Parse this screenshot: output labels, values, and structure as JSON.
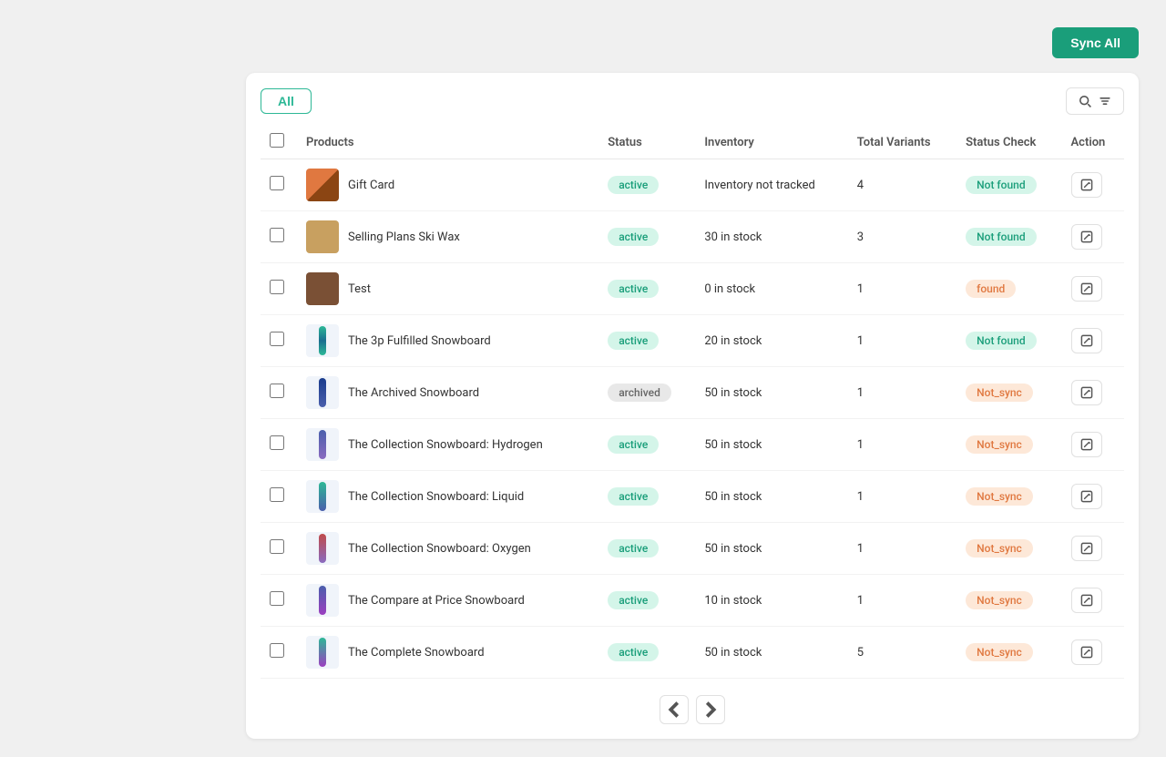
{
  "header": {
    "sync_all_label": "Sync All"
  },
  "toolbar": {
    "all_label": "All",
    "search_placeholder": "Search"
  },
  "table": {
    "columns": [
      "Products",
      "Status",
      "Inventory",
      "Total Variants",
      "Status Check",
      "Action"
    ],
    "rows": [
      {
        "id": 1,
        "name": "Gift Card",
        "img_type": "gift",
        "status": "active",
        "status_badge_class": "badge-active",
        "inventory": "Inventory not tracked",
        "total_variants": "4",
        "status_check": "Not found",
        "status_check_class": "badge-not-found"
      },
      {
        "id": 2,
        "name": "Selling Plans Ski Wax",
        "img_type": "ski",
        "status": "active",
        "status_badge_class": "badge-active",
        "inventory": "30 in stock",
        "total_variants": "3",
        "status_check": "Not found",
        "status_check_class": "badge-not-found"
      },
      {
        "id": 3,
        "name": "Test",
        "img_type": "test",
        "status": "active",
        "status_badge_class": "badge-active",
        "inventory": "0 in stock",
        "total_variants": "1",
        "status_check": "found",
        "status_check_class": "badge-found"
      },
      {
        "id": 4,
        "name": "The 3p Fulfilled Snowboard",
        "img_type": "3p",
        "status": "active",
        "status_badge_class": "badge-active",
        "inventory": "20 in stock",
        "total_variants": "1",
        "status_check": "Not found",
        "status_check_class": "badge-not-found"
      },
      {
        "id": 5,
        "name": "The Archived Snowboard",
        "img_type": "archived",
        "status": "archived",
        "status_badge_class": "badge-archived",
        "inventory": "50 in stock",
        "total_variants": "1",
        "status_check": "Not_sync",
        "status_check_class": "badge-not-sync"
      },
      {
        "id": 6,
        "name": "The Collection Snowboard: Hydrogen",
        "img_type": "hydrogen",
        "status": "active",
        "status_badge_class": "badge-active",
        "inventory": "50 in stock",
        "total_variants": "1",
        "status_check": "Not_sync",
        "status_check_class": "badge-not-sync"
      },
      {
        "id": 7,
        "name": "The Collection Snowboard: Liquid",
        "img_type": "liquid",
        "status": "active",
        "status_badge_class": "badge-active",
        "inventory": "50 in stock",
        "total_variants": "1",
        "status_check": "Not_sync",
        "status_check_class": "badge-not-sync"
      },
      {
        "id": 8,
        "name": "The Collection Snowboard: Oxygen",
        "img_type": "oxygen",
        "status": "active",
        "status_badge_class": "badge-active",
        "inventory": "50 in stock",
        "total_variants": "1",
        "status_check": "Not_sync",
        "status_check_class": "badge-not-sync"
      },
      {
        "id": 9,
        "name": "The Compare at Price Snowboard",
        "img_type": "compare",
        "status": "active",
        "status_badge_class": "badge-active",
        "inventory": "10 in stock",
        "total_variants": "1",
        "status_check": "Not_sync",
        "status_check_class": "badge-not-sync"
      },
      {
        "id": 10,
        "name": "The Complete Snowboard",
        "img_type": "complete",
        "status": "active",
        "status_badge_class": "badge-active",
        "inventory": "50 in stock",
        "total_variants": "5",
        "status_check": "Not_sync",
        "status_check_class": "badge-not-sync"
      }
    ]
  },
  "pagination": {
    "prev_label": "‹",
    "next_label": "›"
  },
  "colors": {
    "accent": "#1a9e7a",
    "badge_active_bg": "#d4f5e9",
    "badge_active_text": "#1a9e7a",
    "badge_not_found_bg": "#d4f5e9",
    "badge_not_found_text": "#1a9e7a",
    "badge_found_bg": "#fde8d8",
    "badge_found_text": "#e07840",
    "badge_not_sync_bg": "#fde8d8",
    "badge_not_sync_text": "#e07840"
  }
}
